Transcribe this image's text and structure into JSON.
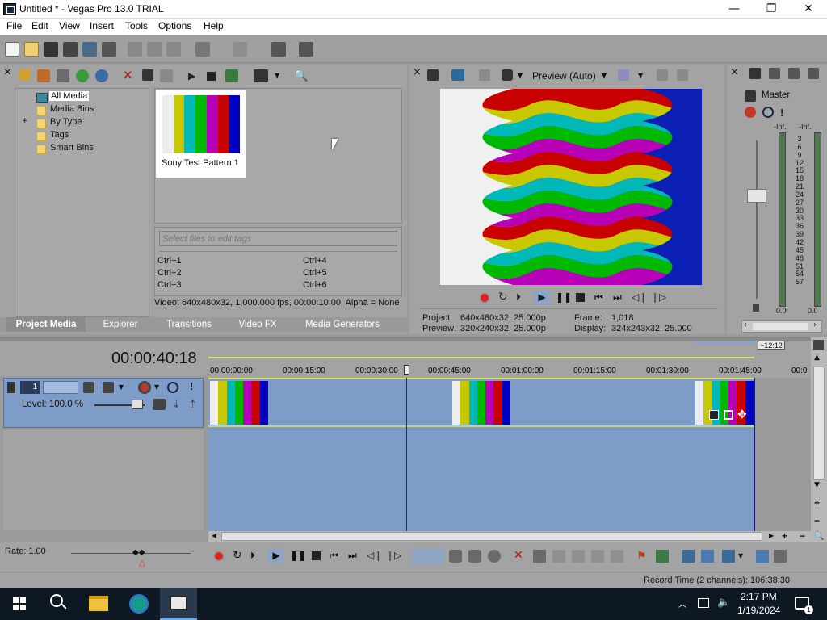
{
  "window": {
    "title": "Untitled * - Vegas Pro 13.0 TRIAL",
    "minimize": "—",
    "maximize": "❐",
    "close": "✕"
  },
  "menu": [
    "File",
    "Edit",
    "View",
    "Insert",
    "Tools",
    "Options",
    "Help"
  ],
  "media_tree": {
    "items": [
      "All Media",
      "Media Bins",
      "By Type",
      "Tags",
      "Smart Bins"
    ],
    "expand_glyph": "+"
  },
  "media_item": {
    "label": "Sony Test Pattern 1"
  },
  "tags": {
    "placeholder": "Select files to edit tags",
    "shortcuts": [
      "Ctrl+1",
      "Ctrl+2",
      "Ctrl+3",
      "Ctrl+4",
      "Ctrl+5",
      "Ctrl+6"
    ]
  },
  "media_info": "Video: 640x480x32, 1,000.000 fps, 00:00:10:00, Alpha = None",
  "tabs": [
    "Project Media",
    "Explorer",
    "Transitions",
    "Video FX",
    "Media Generators"
  ],
  "preview": {
    "mode": "Preview (Auto)",
    "project_label": "Project:",
    "project_value": "640x480x32, 25.000p",
    "preview_label": "Preview:",
    "preview_value": "320x240x32, 25.000p",
    "frame_label": "Frame:",
    "frame_value": "1,018",
    "display_label": "Display:",
    "display_value": "324x243x32, 25.000"
  },
  "master": {
    "label": "Master",
    "left_db": "-Inf.",
    "right_db": "-Inf.",
    "scale": [
      "3",
      "6",
      "9",
      "12",
      "15",
      "18",
      "21",
      "24",
      "27",
      "30",
      "33",
      "36",
      "39",
      "42",
      "45",
      "48",
      "51",
      "54",
      "57"
    ],
    "bottom_left": "0.0",
    "bottom_right": "0.0"
  },
  "timeline": {
    "timecode": "00:00:40:18",
    "ruler": [
      "00:00:00:00",
      "00:00:15:00",
      "00:00:30:00",
      "00:00:45:00",
      "00:01:00:00",
      "00:01:15:00",
      "00:01:30:00",
      "00:01:45:00",
      "00:0"
    ],
    "end_marker": "+12:12",
    "track_number": "1",
    "level": "Level: 100.0 %",
    "rate": "Rate: 1.00"
  },
  "status": {
    "record_time": "Record Time (2 channels): 106:38:30"
  },
  "taskbar": {
    "time": "2:17 PM",
    "date": "1/19/2024"
  },
  "colors": {
    "bars": [
      "#ededed",
      "#c8c800",
      "#00b8b8",
      "#00b800",
      "#b800b8",
      "#c80000",
      "#0000c0"
    ],
    "track_blue": "#7e9cc8",
    "panel_gray": "#a3a3a3",
    "active_tab": "#8c8c8c"
  }
}
